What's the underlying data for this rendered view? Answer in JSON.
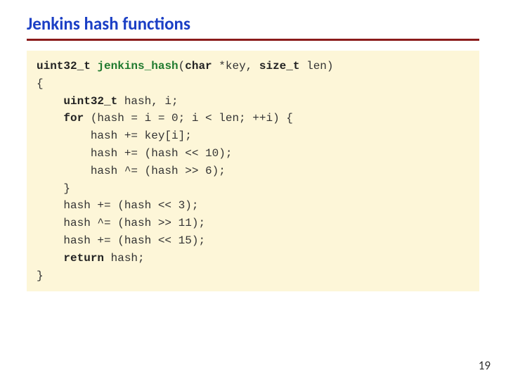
{
  "title": "Jenkins hash functions",
  "page_number": "19",
  "code": {
    "l1a": "uint32_t",
    "l1b": "jenkins_hash",
    "l1c": "(",
    "l1d": "char",
    "l1e": " *key, ",
    "l1f": "size_t",
    "l1g": " len)",
    "l2": "{",
    "l3a": "    ",
    "l3b": "uint32_t",
    "l3c": " hash, i;",
    "l4a": "    ",
    "l4b": "for",
    "l4c": " (hash = i = 0; i < len; ++i) {",
    "l5": "        hash += key[i];",
    "l6": "        hash += (hash << 10);",
    "l7": "        hash ^= (hash >> 6);",
    "l8": "    }",
    "l9": "    hash += (hash << 3);",
    "l10": "    hash ^= (hash >> 11);",
    "l11": "    hash += (hash << 15);",
    "l12a": "    ",
    "l12b": "return",
    "l12c": " hash;",
    "l13": "}"
  }
}
